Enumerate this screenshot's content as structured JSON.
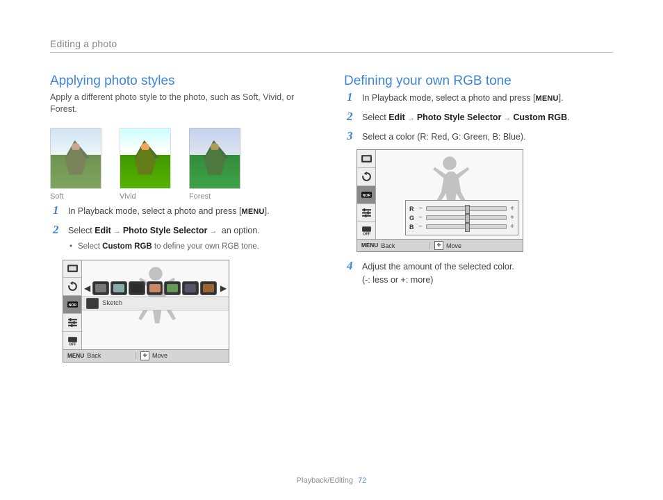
{
  "section_header": "Editing a photo",
  "footer": {
    "label": "Playback/Editing",
    "page": "72"
  },
  "left": {
    "title": "Applying photo styles",
    "intro": "Apply a different photo style to the photo, such as Soft, Vivid, or Forest.",
    "thumbs": [
      {
        "caption": "Soft"
      },
      {
        "caption": "Vivid"
      },
      {
        "caption": "Forest"
      }
    ],
    "steps": [
      {
        "n": "1",
        "pre": "In Playback mode, select a photo and press [",
        "menu": "MENU",
        "post": "]."
      },
      {
        "n": "2",
        "plain_pre": "Select ",
        "bold1": "Edit",
        "bold2": "Photo Style Selector",
        "plain_mid": " an option.",
        "sub_pre": "Select ",
        "sub_bold": "Custom RGB",
        "sub_post": " to define your own RGB tone."
      }
    ],
    "screen": {
      "sketch_label": "Sketch",
      "back": "Back",
      "move": "Move",
      "menu_icon": "MENU"
    }
  },
  "right": {
    "title": "Defining your own RGB tone",
    "steps": [
      {
        "n": "1",
        "pre": "In Playback mode, select a photo and press [",
        "menu": "MENU",
        "post": "]."
      },
      {
        "n": "2",
        "plain_pre": "Select ",
        "bold1": "Edit",
        "bold2": "Photo Style Selector",
        "bold3": "Custom RGB",
        "plain_post": "."
      },
      {
        "n": "3",
        "text": "Select a color (R: Red, G: Green, B: Blue)."
      },
      {
        "n": "4",
        "line1": "Adjust the amount of the selected color.",
        "line2": "(-: less or +: more)"
      }
    ],
    "screen": {
      "rgb_labels": [
        "R",
        "G",
        "B"
      ],
      "back": "Back",
      "move": "Move",
      "menu_icon": "MENU"
    }
  }
}
